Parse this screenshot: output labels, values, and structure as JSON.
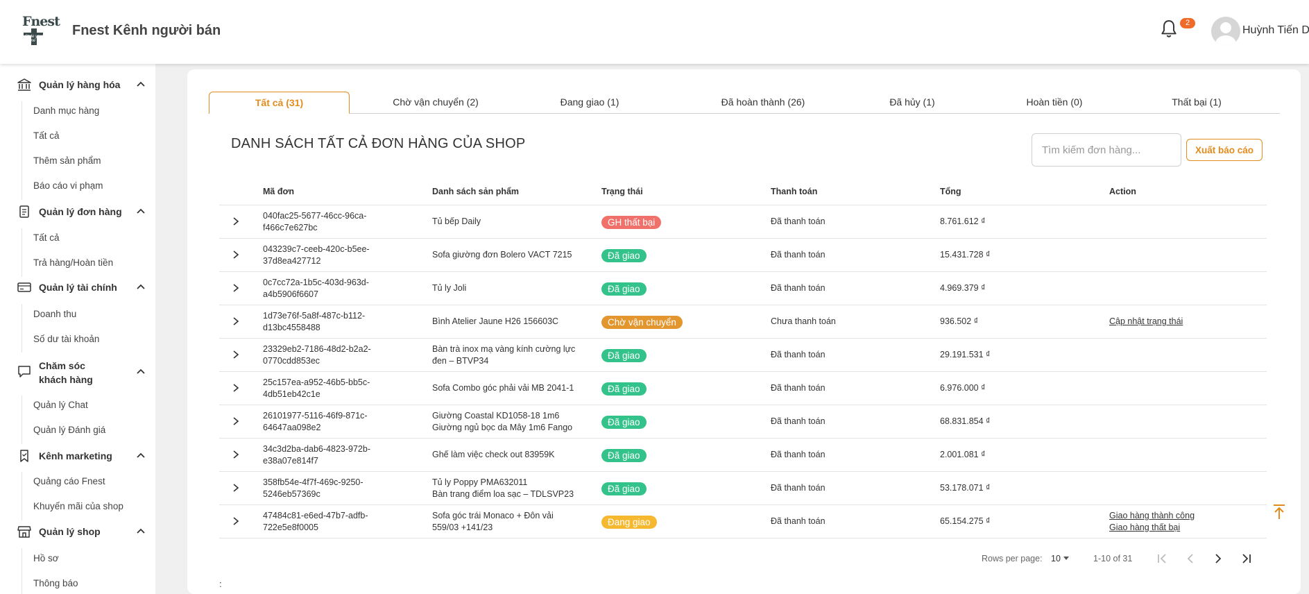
{
  "header": {
    "logo_text": "Fnest",
    "logo_tagline": "Style your home",
    "brand": "Fnest Kênh người bán",
    "notification_count": "2",
    "user_name": "Huỳnh Tiến Dũng"
  },
  "sidebar": {
    "groups": [
      {
        "title": "Quản lý hàng hóa",
        "icon": "bank-icon",
        "items": [
          "Danh mục hàng",
          "Tất cả",
          "Thêm sản phẩm",
          "Báo cáo vi phạm"
        ]
      },
      {
        "title": "Quản lý đơn hàng",
        "icon": "clipboard-icon",
        "items": [
          "Tất cả",
          "Trả hàng/Hoàn tiền"
        ]
      },
      {
        "title": "Quản lý tài chính",
        "icon": "credit-card-icon",
        "items": [
          "Doanh thu",
          "Số dư tài khoản"
        ]
      },
      {
        "title": "Chăm sóc khách hàng",
        "icon": "chat-bubble-icon",
        "items": [
          "Quản lý Chat",
          "Quản lý Đánh giá"
        ]
      },
      {
        "title": "Kênh marketing",
        "icon": "bookmark-icon",
        "items": [
          "Quảng cáo Fnest",
          "Khuyến mãi của shop"
        ]
      },
      {
        "title": "Quản lý shop",
        "icon": "shop-icon",
        "items": [
          "Hồ sơ",
          "Thông báo"
        ]
      }
    ]
  },
  "tabs": [
    {
      "label": "Tất cả (31)",
      "active": true
    },
    {
      "label": "Chờ vận chuyển (2)",
      "active": false
    },
    {
      "label": "Đang giao (1)",
      "active": false
    },
    {
      "label": "Đã hoàn thành (26)",
      "active": false
    },
    {
      "label": "Đã hủy (1)",
      "active": false
    },
    {
      "label": "Hoàn tiền (0)",
      "active": false
    },
    {
      "label": "Thất bại (1)",
      "active": false
    }
  ],
  "main": {
    "title": "DANH SÁCH TẤT CẢ ĐƠN HÀNG CỦA SHOP",
    "search_placeholder": "Tìm kiếm đơn hàng...",
    "export_label": "Xuất báo cáo"
  },
  "table": {
    "columns": [
      "Mã đơn",
      "Danh sách sản phẩm",
      "Trạng thái",
      "Thanh toán",
      "Tổng",
      "Action"
    ],
    "rows": [
      {
        "id_1": "040fac25-5677-46cc-96ca-",
        "id_2": "f466c7e627bc",
        "products": [
          "Tủ bếp Daily"
        ],
        "status": "GH thất bại",
        "status_color": "#f0706a",
        "payment": "Đã thanh toán",
        "total": "8.761.612 ₫",
        "actions": []
      },
      {
        "id_1": "043239c7-ceeb-420c-b5ee-",
        "id_2": "37d8ea427712",
        "products": [
          "Sofa giường đơn Bolero VACT 7215"
        ],
        "status": "Đã giao",
        "status_color": "#33c38a",
        "payment": "Đã thanh toán",
        "total": "15.431.728 ₫",
        "actions": []
      },
      {
        "id_1": "0c7cc72a-1b5c-403d-963d-",
        "id_2": "a4b5906f6607",
        "products": [
          "Tủ ly Joli"
        ],
        "status": "Đã giao",
        "status_color": "#33c38a",
        "payment": "Đã thanh toán",
        "total": "4.969.379 ₫",
        "actions": []
      },
      {
        "id_1": "1d73e76f-5a8f-487c-b112-",
        "id_2": "d13bc4558488",
        "products": [
          "Bình Atelier Jaune H26 156603C"
        ],
        "status": "Chờ vận chuyển",
        "status_color": "#e3962e",
        "payment": "Chưa thanh toán",
        "total": "936.502 ₫",
        "actions": [
          "Cập nhật trạng thái"
        ]
      },
      {
        "id_1": "23329eb2-7186-48d2-b2a2-",
        "id_2": "0770cdd853ec",
        "products": [
          "Bàn trà inox mạ vàng kính cường lực",
          "đen – BTVP34"
        ],
        "status": "Đã giao",
        "status_color": "#33c38a",
        "payment": "Đã thanh toán",
        "total": "29.191.531 ₫",
        "actions": []
      },
      {
        "id_1": "25c157ea-a952-46b5-bb5c-",
        "id_2": "4db51eb42c1e",
        "products": [
          "Sofa Combo góc phải vải MB 2041-1"
        ],
        "status": "Đã giao",
        "status_color": "#33c38a",
        "payment": "Đã thanh toán",
        "total": "6.976.000 ₫",
        "actions": []
      },
      {
        "id_1": "26101977-5116-46f9-871c-",
        "id_2": "64647aa098e2",
        "products": [
          "Giường Coastal KD1058-18 1m6",
          "Giường ngủ bọc da Mây 1m6 Fango"
        ],
        "status": "Đã giao",
        "status_color": "#33c38a",
        "payment": "Đã thanh toán",
        "total": "68.831.854 ₫",
        "actions": []
      },
      {
        "id_1": "34c3d2ba-dab6-4823-972b-",
        "id_2": "e38a07e814f7",
        "products": [
          "Ghế làm việc check out 83959K"
        ],
        "status": "Đã giao",
        "status_color": "#33c38a",
        "payment": "Đã thanh toán",
        "total": "2.001.081 ₫",
        "actions": []
      },
      {
        "id_1": "358fb54e-4f7f-469c-9250-",
        "id_2": "5246eb57369c",
        "products": [
          "Tủ ly Poppy PMA632011",
          "Bàn trang điểm loa sạc – TDLSVP23"
        ],
        "status": "Đã giao",
        "status_color": "#33c38a",
        "payment": "Đã thanh toán",
        "total": "53.178.071 ₫",
        "actions": []
      },
      {
        "id_1": "47484c81-e6ed-47b7-adfb-",
        "id_2": "722e5e8f0005",
        "products": [
          "Sofa góc trái Monaco + Đôn vải",
          "559/03 +141/23"
        ],
        "status": "Đang giao",
        "status_color": "#f5b82e",
        "payment": "Đã thanh toán",
        "total": "65.154.275 ₫",
        "actions": [
          "Giao hàng thành công",
          "Giao hàng thất bại"
        ]
      }
    ]
  },
  "pagination": {
    "rows_per_page_label": "Rows per page:",
    "rows_per_page": "10",
    "range": "1-10 of 31"
  },
  "footer_text": ":"
}
